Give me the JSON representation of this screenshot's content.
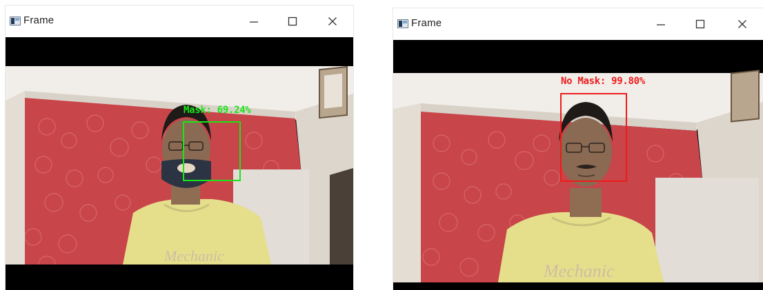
{
  "windows": [
    {
      "title": "Frame",
      "icon": "opencv-frame-icon",
      "controls": [
        "minimize",
        "maximize",
        "close"
      ],
      "detection": {
        "label": "Mask: 69.24%",
        "color": "#19e619"
      }
    },
    {
      "title": "Frame",
      "icon": "opencv-frame-icon",
      "controls": [
        "minimize",
        "maximize",
        "close"
      ],
      "detection": {
        "label": "No Mask: 99.80%",
        "color": "#ee1b1b"
      }
    }
  ],
  "colors": {
    "wall_red": "#c8454a",
    "ceiling": "#ebe7e2",
    "shirt": "#e6e08e",
    "skin": "#8a6a52",
    "mask": "#2c3444"
  }
}
